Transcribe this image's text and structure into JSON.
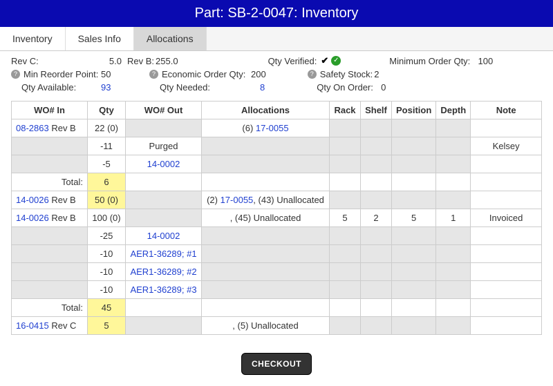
{
  "title": "Part: SB-2-0047: Inventory",
  "tabs": {
    "inventory": "Inventory",
    "sales": "Sales Info",
    "allocations": "Allocations"
  },
  "summary": {
    "revC_label": "Rev C:",
    "revC_val": "5.0",
    "revB_label": "Rev B:",
    "revB_val": "255.0",
    "qtyVerified_label": "Qty Verified:",
    "minOrder_label": "Minimum Order Qty:",
    "minOrder_val": "100",
    "minReorder_label": "Min Reorder Point:",
    "minReorder_val": "50",
    "eoq_label": "Economic Order Qty:",
    "eoq_val": "200",
    "safety_label": "Safety Stock:",
    "safety_val": "2",
    "qtyAvail_label": "Qty Available:",
    "qtyAvail_val": "93",
    "qtyNeeded_label": "Qty Needed:",
    "qtyNeeded_val": "8",
    "qtyOnOrder_label": "Qty On Order:",
    "qtyOnOrder_val": "0"
  },
  "columns": {
    "woIn": "WO# In",
    "qty": "Qty",
    "woOut": "WO# Out",
    "alloc": "Allocations",
    "rack": "Rack",
    "shelf": "Shelf",
    "pos": "Position",
    "depth": "Depth",
    "note": "Note"
  },
  "rows": {
    "r1_in_link": "08-2863",
    "r1_in_suffix": " Rev B",
    "r1_qty": "22 (0)",
    "r1_alloc_pre": "(6) ",
    "r1_alloc_link": "17-0055",
    "r2_qty": "-11",
    "r2_out": "Purged",
    "r2_note": "Kelsey",
    "r3_qty": "-5",
    "r3_out": "14-0002",
    "r4_in": "Total:",
    "r4_qty": "6",
    "r5_in_link": "14-0026",
    "r5_in_suffix": " Rev B",
    "r5_qty": "50 (0)",
    "r5_alloc_pre": "(2) ",
    "r5_alloc_link": "17-0055",
    "r5_alloc_post": ", (43) Unallocated",
    "r6_in_link": "14-0026",
    "r6_in_suffix": " Rev B",
    "r6_qty": "100 (0)",
    "r6_alloc": ", (45) Unallocated",
    "r6_rack": "5",
    "r6_shelf": "2",
    "r6_pos": "5",
    "r6_depth": "1",
    "r6_note": "Invoiced",
    "r7_qty": "-25",
    "r7_out": "14-0002",
    "r8_qty": "-10",
    "r8_out": "AER1-36289; #1",
    "r9_qty": "-10",
    "r9_out": "AER1-36289; #2",
    "r10_qty": "-10",
    "r10_out": "AER1-36289; #3",
    "r11_in": "Total:",
    "r11_qty": "45",
    "r12_in_link": "16-0415",
    "r12_in_suffix": " Rev C",
    "r12_qty": "5",
    "r12_alloc": ", (5) Unallocated"
  },
  "checkout": "CHECKOUT"
}
